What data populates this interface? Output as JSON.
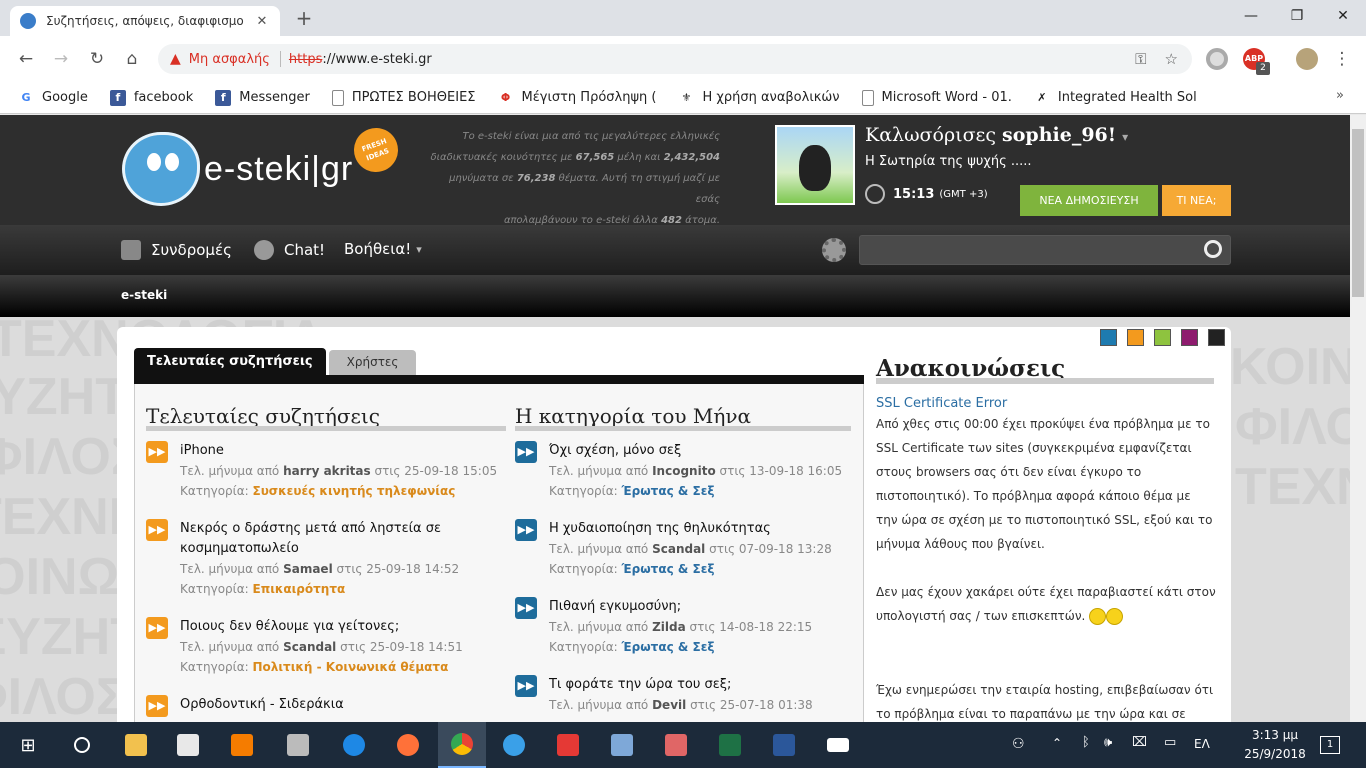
{
  "browser": {
    "tab_title": "Συζητήσεις, απόψεις, διαφιφισμο",
    "new_tab": "+",
    "close_tab": "✕",
    "window": {
      "minimize": "—",
      "restore": "❐",
      "close": "✕"
    },
    "nav": {
      "back": "←",
      "forward": "→",
      "reload": "↻",
      "home": "⌂"
    },
    "address": {
      "warning_icon": "▲",
      "insecure_label": "Μη ασφαλής",
      "scheme": "https",
      "rest": "://www.e-steki.gr"
    },
    "ext_badge": "2",
    "bookmarks": [
      {
        "label": "Google",
        "icon": "google-icon",
        "glyph": "G",
        "color": "#4285f4"
      },
      {
        "label": "facebook",
        "icon": "facebook-icon",
        "glyph": "f",
        "color": "#3b5998"
      },
      {
        "label": "Messenger",
        "icon": "facebook-icon",
        "glyph": "f",
        "color": "#3b5998"
      },
      {
        "label": "ΠΡΩΤΕΣ ΒΟΗΘΕΙΕΣ",
        "icon": "page-icon",
        "glyph": "",
        "color": "#888"
      },
      {
        "label": "Μέγιστη Πρόσληψη (",
        "icon": "pharma-icon",
        "glyph": "Φ",
        "color": "#d93025"
      },
      {
        "label": "Η χρήση αναβολικών",
        "icon": "emblem-icon",
        "glyph": "⚜",
        "color": "#555"
      },
      {
        "label": "Microsoft Word - 01.",
        "icon": "page-icon",
        "glyph": "",
        "color": "#888"
      },
      {
        "label": "Integrated Health Sol",
        "icon": "caduceus-icon",
        "glyph": "✗",
        "color": "#555"
      }
    ],
    "bookmarks_more": "»"
  },
  "site": {
    "logo_word": "e-steki|gr",
    "logo_badge": "FRESH IDEAS",
    "intro": {
      "l1": "Το e-steki είναι μια από τις μεγαλύτερες ελληνικές",
      "l2a": "διαδικτυακές κοινότητες με ",
      "members": "67,565",
      "l2b": " μέλη και ",
      "posts": "2,432,504",
      "l3a": "μηνύματα σε ",
      "threads": "76,238",
      "l3b": " θέματα. Αυτή τη στιγμή μαζί με εσάς",
      "l4a": "απολαμβάνουν το e-steki άλλα ",
      "online": "482",
      "l4b": " άτομα."
    },
    "user": {
      "welcome": "Καλωσόρισες",
      "name": "sophie_96!",
      "caret": "▾",
      "subtitle": "Η Σωτηρία της ψυχής .....",
      "time": "15:13",
      "gmt": "(GMT +3)"
    },
    "btn_new_post": "ΝΕΑ ΔΗΜΟΣΙΕΥΣΗ",
    "btn_whats_new": "ΤΙ ΝΕΑ;",
    "navbar": {
      "subscriptions": "Συνδρομές",
      "chat": "Chat!",
      "help": "Βοήθεια!",
      "help_caret": "▾"
    },
    "breadcrumb": "e-steki",
    "watermark": [
      "ΤΕΧΝΟΛΟΓΙΑ",
      "ΣΥΖΗΤΗΣΕΙΣ",
      "ΦΙΛΟΣΟΦΙΑ",
      "ΤΕΧΝΗ",
      "ΚΟΙΝΩΝΙΑ",
      "ΣΥΖΗΤΗΣΕΙΣ",
      "ΦΙΛΟΣΟΦΙΑ"
    ],
    "swatches": [
      "#1e7bb0",
      "#f39a1e",
      "#8ec33f",
      "#8e1b6e",
      "#222222"
    ],
    "tabs": {
      "latest": "Τελευταίες συζητήσεις",
      "users": "Χρήστες"
    },
    "latest": {
      "heading": "Τελευταίες συζητήσεις",
      "items": [
        {
          "title": "iPhone",
          "by": "harry akritas",
          "when": "25-09-18 15:05",
          "category": "Συσκευές κινητής τηλεφωνίας"
        },
        {
          "title": "Νεκρός ο δράστης μετά από ληστεία σε κοσμηματοπωλείο",
          "by": "Samael",
          "when": "25-09-18 14:52",
          "category": "Επικαιρότητα"
        },
        {
          "title": "Ποιους δεν θέλουμε για γείτονες;",
          "by": "Scandal",
          "when": "25-09-18 14:51",
          "category": "Πολιτική - Κοινωνικά θέματα"
        },
        {
          "title": "Ορθοδοντική - Σιδεράκια",
          "by": "",
          "when": "",
          "category": ""
        }
      ]
    },
    "monthly": {
      "heading": "Η κατηγορία του Μήνα",
      "items": [
        {
          "title": "Όχι σχέση, μόνο σεξ",
          "by": "Incognito",
          "when": "13-09-18 16:05",
          "category": "Έρωτας & Σεξ"
        },
        {
          "title": "Η χυδαιοποίηση της θηλυκότητας",
          "by": "Scandal",
          "when": "07-09-18 13:28",
          "category": "Έρωτας & Σεξ"
        },
        {
          "title": "Πιθανή εγκυμοσύνη;",
          "by": "Zilda",
          "when": "14-08-18 22:15",
          "category": "Έρωτας & Σεξ"
        },
        {
          "title": "Τι φοράτε την ώρα του σεξ;",
          "by": "Devil",
          "when": "25-07-18 01:38",
          "category": ""
        }
      ]
    },
    "meta_labels": {
      "last_post_by": "Τελ. μήνυμα από ",
      "at": " στις ",
      "category": "Κατηγορία: "
    },
    "announcements": {
      "heading": "Ανακοινώσεις",
      "title": "SSL Certificate Error",
      "p1": "Από χθες στις 00:00 έχει προκύψει ένα πρόβλημα με το SSL Certificate των sites (συγκεκριμένα εμφανίζεται στους browsers σας ότι δεν είναι έγκυρο το πιστοποιητικό). Το πρόβλημα αφορά κάποιο θέμα με την ώρα σε σχέση με το πιστοποιητικό SSL, εξού και το μήνυμα λάθους που βγαίνει.",
      "p2": "Δεν μας έχουν χακάρει ούτε έχει παραβιαστεί κάτι στον υπολογιστή σας / των επισκεπτών.",
      "p3": "Έχω ενημερώσει την εταιρία hosting, επιβεβαίωσαν ότι το πρόβλημα είναι το παραπάνω με την ώρα και σε"
    }
  },
  "taskbar": {
    "apps": [
      {
        "icon": "file-explorer-icon",
        "color": "#f2c14e"
      },
      {
        "icon": "store-icon",
        "color": "#e8e8e8"
      },
      {
        "icon": "media-player-icon",
        "color": "#f57c00"
      },
      {
        "icon": "calculator-icon",
        "color": "#bbbbbb"
      },
      {
        "icon": "edge-icon",
        "color": "#1e88e5"
      },
      {
        "icon": "firefox-icon",
        "color": "#ff7139"
      },
      {
        "icon": "chrome-icon",
        "color": "#34a853"
      },
      {
        "icon": "internet-explorer-icon",
        "color": "#3aa0e8"
      },
      {
        "icon": "acrobat-icon",
        "color": "#e53935"
      },
      {
        "icon": "paint-icon",
        "color": "#7ea8d8"
      },
      {
        "icon": "snipping-tool-icon",
        "color": "#e06666"
      },
      {
        "icon": "excel-icon",
        "color": "#1e7145"
      },
      {
        "icon": "word-icon",
        "color": "#2b579a"
      },
      {
        "icon": "mail-icon",
        "color": "#ffffff"
      }
    ],
    "language": "ΕΛ",
    "time": "3:13 μμ",
    "date": "25/9/2018",
    "notification_count": "1"
  }
}
